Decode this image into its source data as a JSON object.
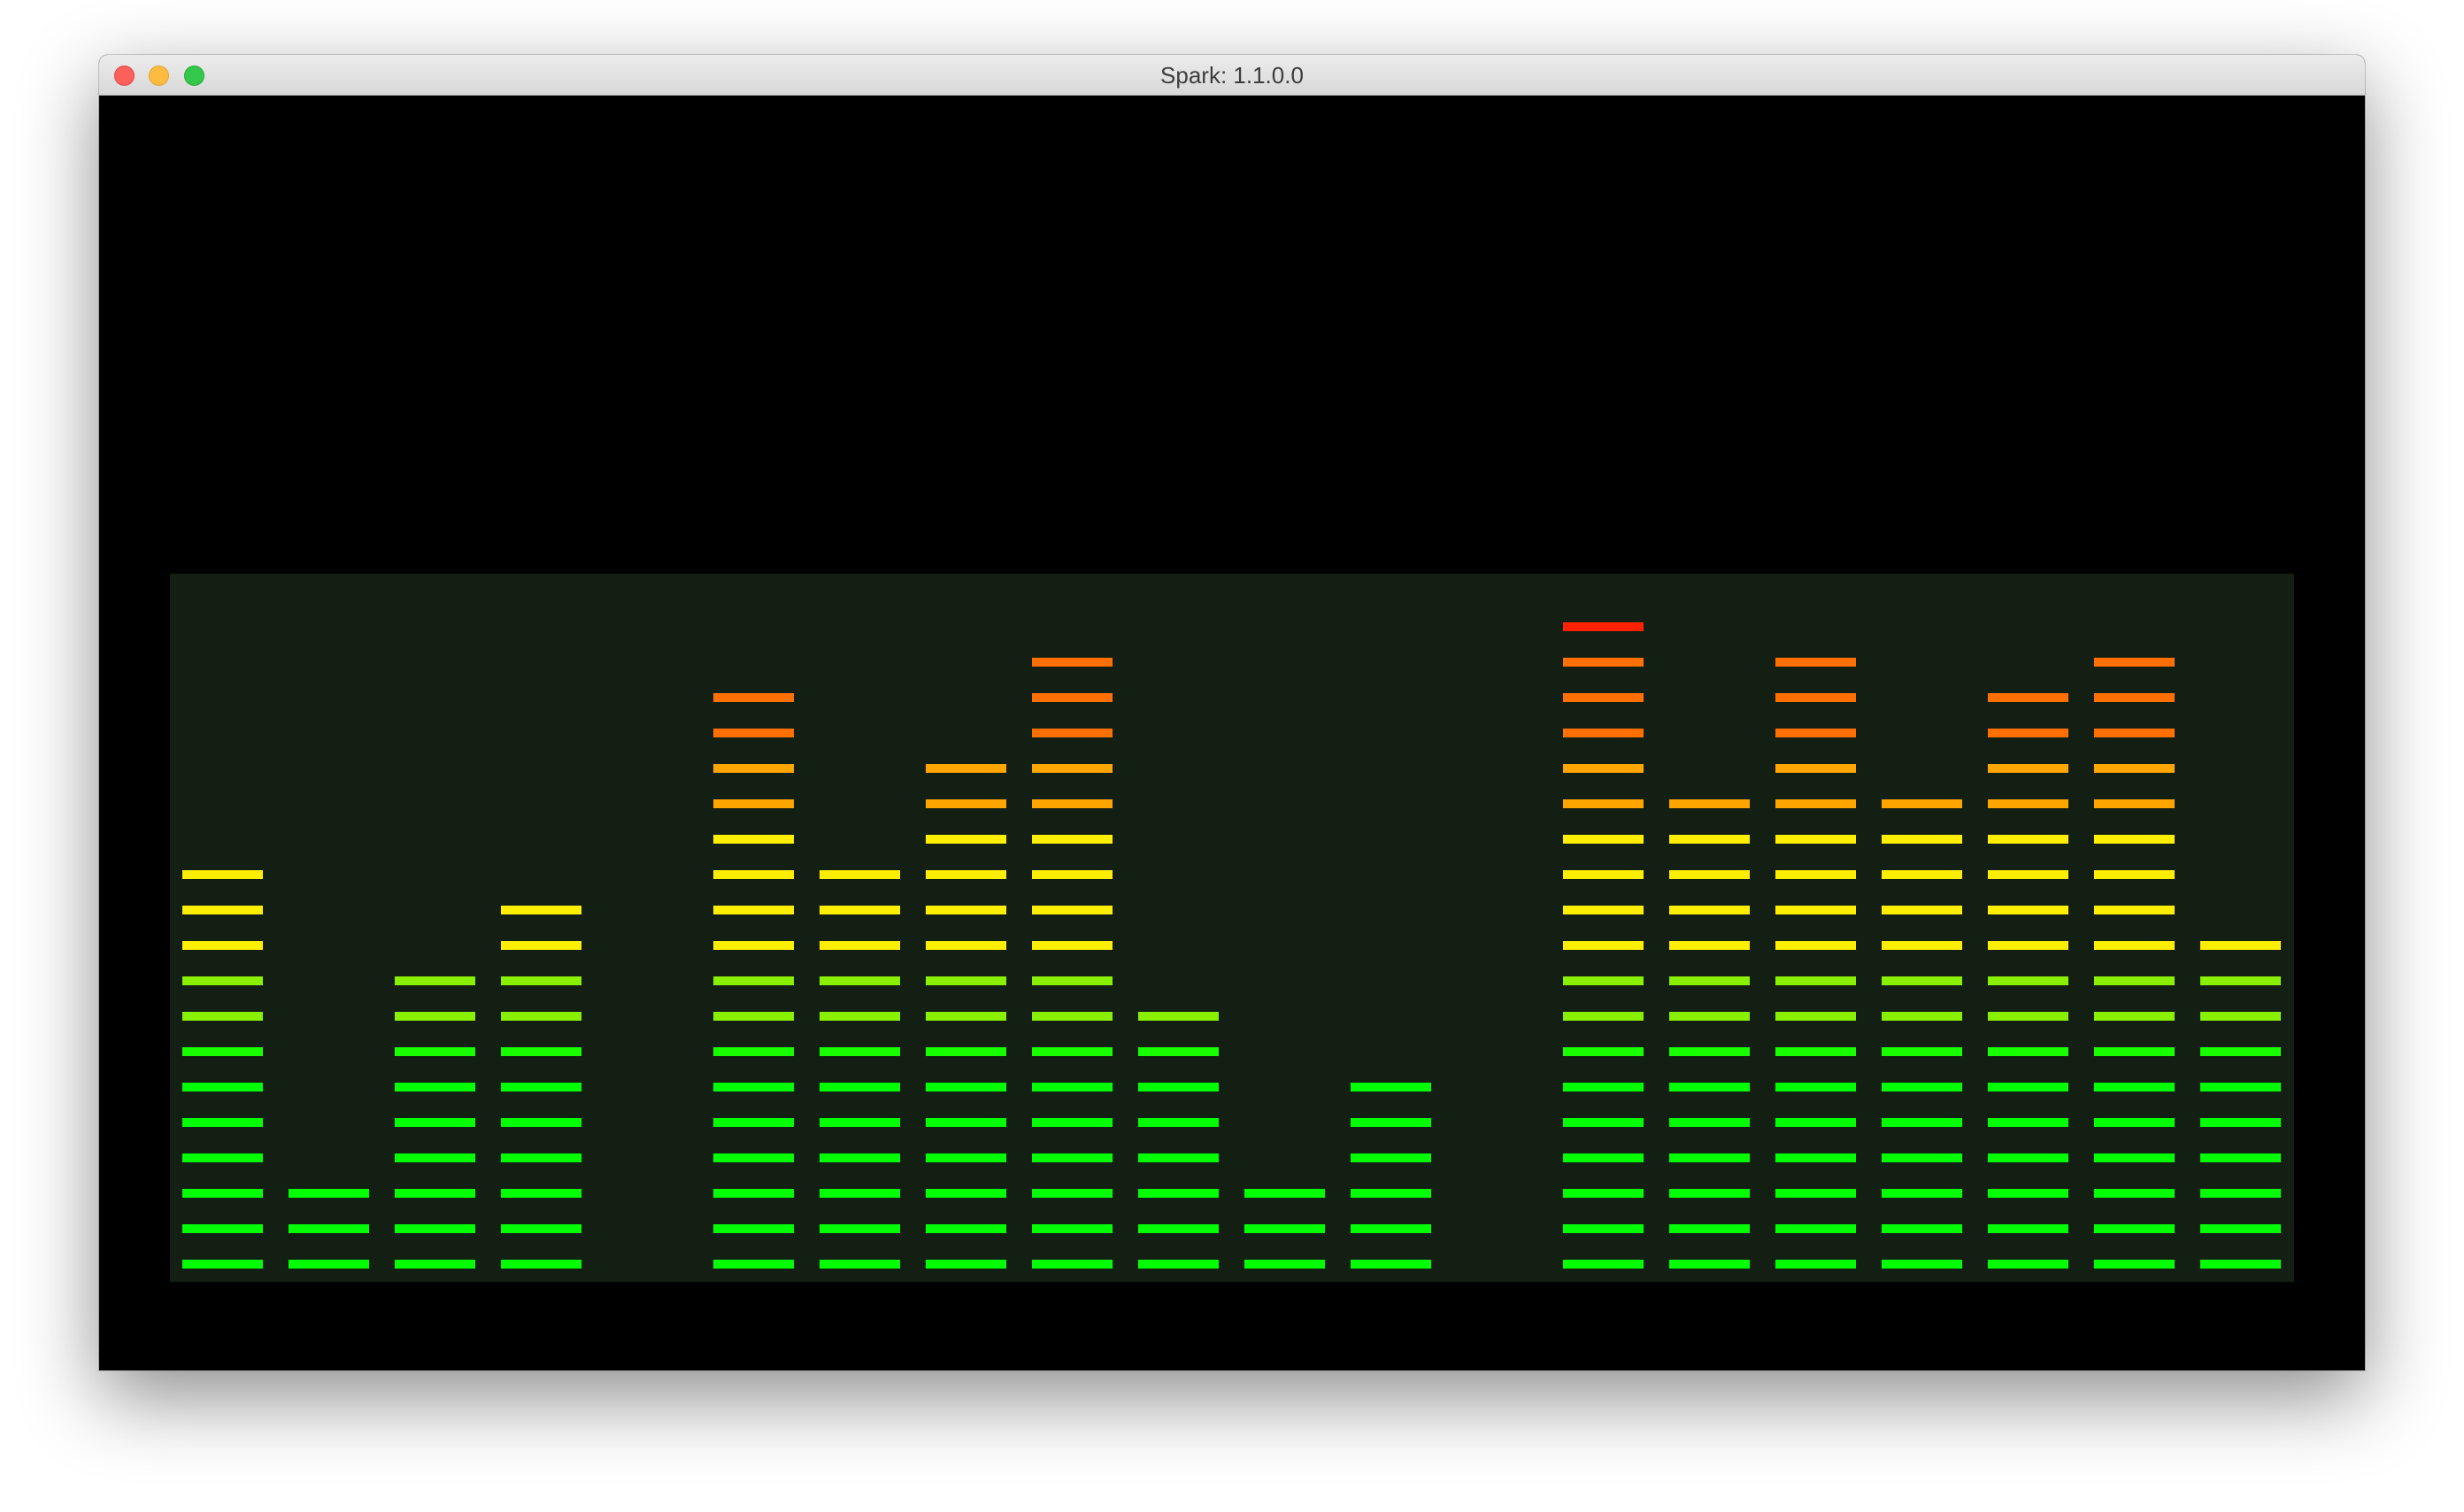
{
  "window": {
    "title": "Spark: 1.1.0.0"
  },
  "visualizer": {
    "type": "spectrum-equalizer",
    "max_segments": 18,
    "background": "#131f12",
    "levels": [
      12,
      3,
      9,
      11,
      0,
      17,
      12,
      15,
      18,
      8,
      3,
      6,
      0,
      19,
      14,
      18,
      14,
      17,
      18,
      10
    ],
    "color_stops": [
      "#00ff00",
      "#17ff00",
      "#88f000",
      "#ffee00",
      "#ffa500",
      "#ff7000",
      "#ff2200"
    ]
  }
}
